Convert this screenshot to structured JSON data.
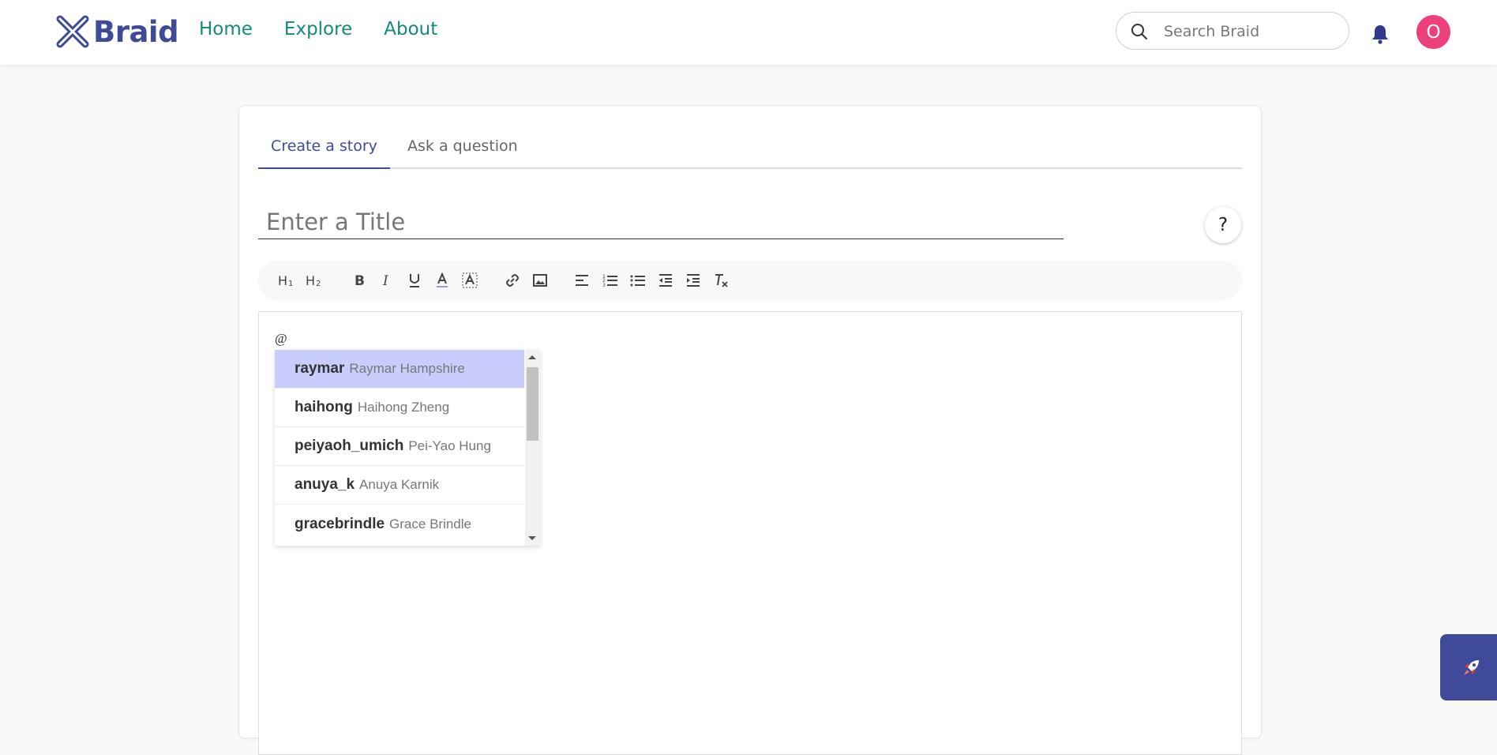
{
  "brand": {
    "name": "Braid",
    "color": "#3f4a9a"
  },
  "nav": {
    "items": [
      "Home",
      "Explore",
      "About"
    ],
    "color": "#138a7a"
  },
  "search": {
    "placeholder": "Search Braid"
  },
  "user": {
    "avatar_initial": "O",
    "avatar_color": "#ec407a"
  },
  "tabs": [
    {
      "label": "Create a story",
      "active": true
    },
    {
      "label": "Ask a question",
      "active": false
    }
  ],
  "editor": {
    "title_placeholder": "Enter a Title",
    "help_label": "?",
    "content": "@",
    "toolbar_icons": [
      "heading-1-icon",
      "heading-2-icon",
      "bold-icon",
      "italic-icon",
      "underline-icon",
      "text-color-icon",
      "highlight-icon",
      "link-icon",
      "image-icon",
      "align-left-icon",
      "ordered-list-icon",
      "bullet-list-icon",
      "outdent-icon",
      "indent-icon",
      "clear-format-icon"
    ]
  },
  "mentions": [
    {
      "username": "raymar",
      "name": "Raymar Hampshire",
      "selected": true
    },
    {
      "username": "haihong",
      "name": "Haihong Zheng",
      "selected": false
    },
    {
      "username": "peiyaoh_umich",
      "name": "Pei-Yao Hung",
      "selected": false
    },
    {
      "username": "anuya_k",
      "name": "Anuya Karnik",
      "selected": false
    },
    {
      "username": "gracebrindle",
      "name": "Grace Brindle",
      "selected": false
    }
  ],
  "fab": {
    "icon": "rocket-icon"
  }
}
